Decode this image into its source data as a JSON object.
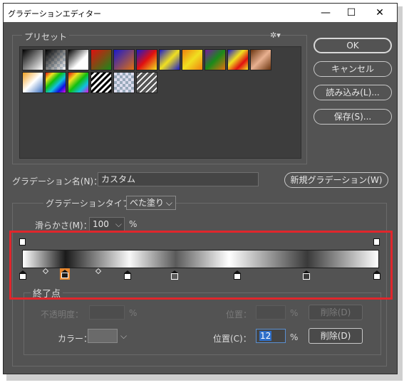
{
  "window": {
    "title": "グラデーションエディター",
    "minimize": "—",
    "maximize": "☐",
    "close": "✕"
  },
  "presets": {
    "label": "プリセット",
    "menu_icon": "gear-icon",
    "menu_glyph": "✲▾"
  },
  "buttons": {
    "ok": "OK",
    "cancel": "キャンセル",
    "load": "読み込み(L)...",
    "save": "保存(S)..."
  },
  "name": {
    "label": "グラデーション名(N)：",
    "value": "カスタム",
    "new_button": "新規グラデーション(W)"
  },
  "type": {
    "label": "グラデーションタイプ：",
    "value": "べた塗り",
    "chevron": "⌵"
  },
  "smoothness": {
    "label": "滑らかさ(M)：",
    "value": "100",
    "chevron": "⌵",
    "unit": "%"
  },
  "stops": {
    "label": "終了点",
    "opacity_label": "不透明度：",
    "opacity_value": "",
    "opacity_unit": "%",
    "opacity_position_label": "位置：",
    "opacity_position_value": "",
    "opacity_position_unit": "%",
    "opacity_delete": "削除(D)",
    "color_label": "カラー：",
    "color_chevron": "⌵",
    "color_position_label": "位置(C)：",
    "color_position_value": "12",
    "color_position_unit": "%",
    "color_delete": "削除(D)"
  },
  "colors": {
    "dialog_bg": "#535353",
    "highlight": "#e0262c",
    "selected_stop": "#e8872e"
  }
}
